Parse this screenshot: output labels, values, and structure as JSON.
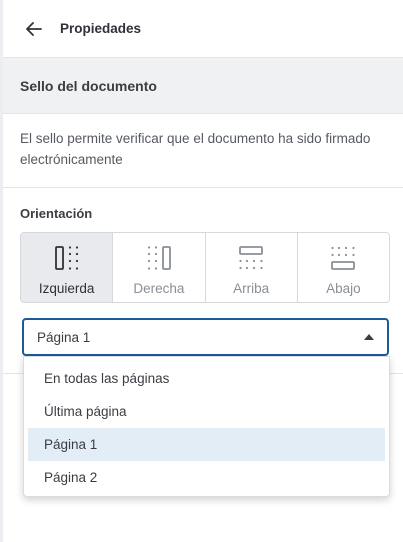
{
  "header": {
    "title": "Propiedades",
    "back_icon": "arrow-left-icon"
  },
  "section": {
    "title": "Sello del documento",
    "description": "El sello permite verificar que el documento ha sido firmado electrónicamente"
  },
  "orientation": {
    "label": "Orientación",
    "selected": "Izquierda",
    "options": [
      {
        "label": "Izquierda",
        "icon": "stamp-left-icon"
      },
      {
        "label": "Derecha",
        "icon": "stamp-right-icon"
      },
      {
        "label": "Arriba",
        "icon": "stamp-top-icon"
      },
      {
        "label": "Abajo",
        "icon": "stamp-bottom-icon"
      }
    ]
  },
  "page_select": {
    "value": "Página 1",
    "icon": "caret-up-icon",
    "options": [
      "En todas las páginas",
      "Última página",
      "Página 1",
      "Página 2"
    ],
    "selected_index": 2
  },
  "colors": {
    "accent": "#1f5a96",
    "selected_option_bg": "#e3edf6",
    "active_button_bg": "#e8eaed",
    "section_bar_bg": "#f0f1f3"
  }
}
